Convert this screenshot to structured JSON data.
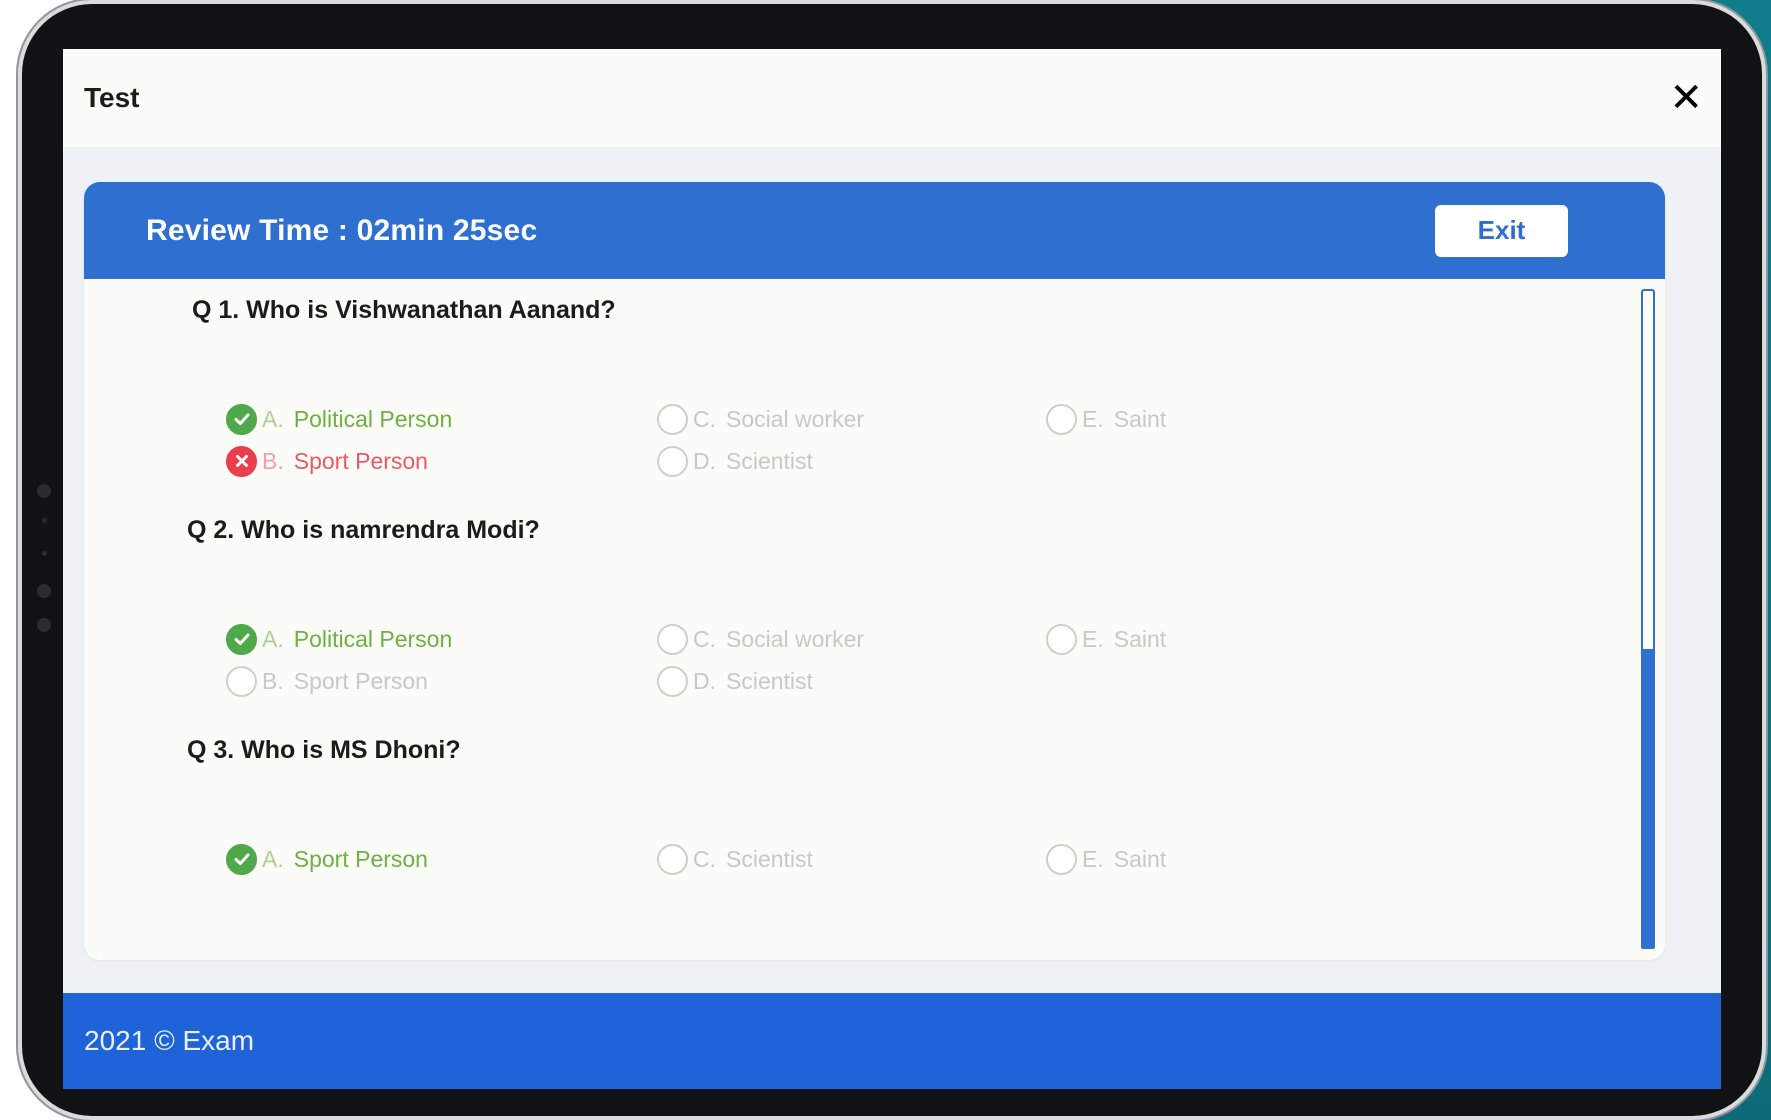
{
  "window": {
    "title": "Test",
    "close_label": "✕"
  },
  "review": {
    "time_label": "Review Time : 02min 25sec",
    "exit_label": "Exit"
  },
  "colors": {
    "accent": "#2e6fd0",
    "correct": "#4ea94a",
    "wrong": "#ea3f4c",
    "footer": "#1f63d8"
  },
  "questions": [
    {
      "title": "Q 1. Who is Vishwanathan Aanand?",
      "options": [
        {
          "letter": "A.",
          "text": "Political Person",
          "state": "correct"
        },
        {
          "letter": "B.",
          "text": "Sport Person",
          "state": "wrong"
        },
        {
          "letter": "C.",
          "text": "Social worker",
          "state": "none"
        },
        {
          "letter": "D.",
          "text": "Scientist",
          "state": "none"
        },
        {
          "letter": "E.",
          "text": "Saint",
          "state": "none"
        }
      ]
    },
    {
      "title": "Q 2. Who is namrendra Modi?",
      "options": [
        {
          "letter": "A.",
          "text": "Political Person",
          "state": "correct"
        },
        {
          "letter": "B.",
          "text": "Sport Person",
          "state": "none"
        },
        {
          "letter": "C.",
          "text": "Social worker",
          "state": "none"
        },
        {
          "letter": "D.",
          "text": "Scientist",
          "state": "none"
        },
        {
          "letter": "E.",
          "text": "Saint",
          "state": "none"
        }
      ]
    },
    {
      "title": "Q 3. Who is MS Dhoni?",
      "options": [
        {
          "letter": "A.",
          "text": "Sport Person",
          "state": "correct"
        },
        {
          "letter": "C.",
          "text": "Scientist",
          "state": "none"
        },
        {
          "letter": "E.",
          "text": "Saint",
          "state": "none"
        }
      ]
    }
  ],
  "footer": {
    "text": "2021 © Exam"
  }
}
